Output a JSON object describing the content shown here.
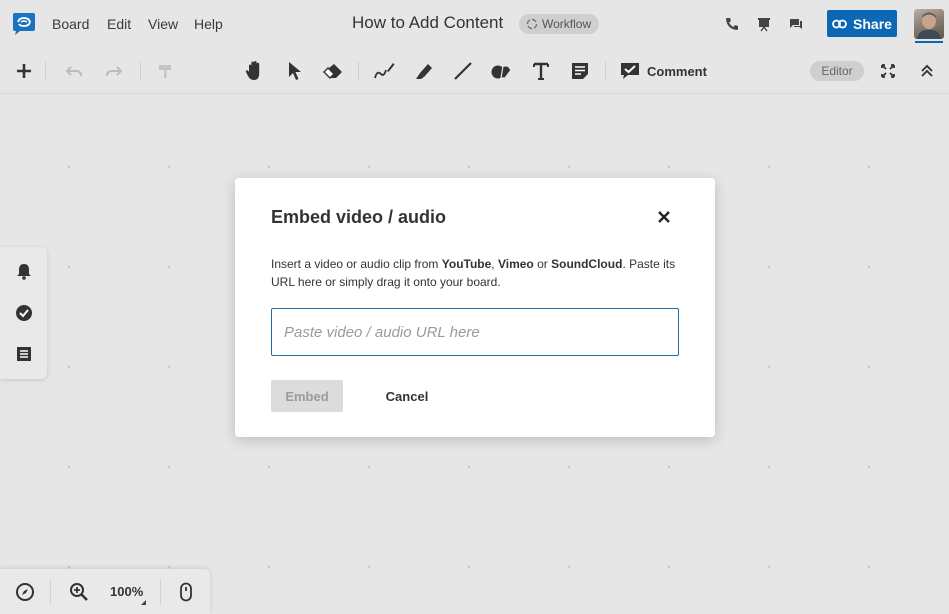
{
  "app": {
    "menu": [
      "Board",
      "Edit",
      "View",
      "Help"
    ],
    "board_title": "How to Add Content",
    "workflow_badge": "Workflow",
    "share_label": "Share",
    "brand_color": "#0d67b5"
  },
  "toolbar": {
    "comment_label": "Comment",
    "editor_badge": "Editor",
    "tools": [
      "add-icon",
      "undo-icon",
      "redo-icon",
      "format-painter-icon",
      "hand-icon",
      "pointer-icon",
      "eraser-icon",
      "pen-icon",
      "highlighter-icon",
      "line-icon",
      "shapes-icon",
      "text-icon",
      "sticky-note-icon",
      "comment-icon",
      "fullscreen-icon",
      "collapse-icon"
    ]
  },
  "left_panel": {
    "icons": [
      "bell-icon",
      "check-circle-icon",
      "list-icon"
    ]
  },
  "bottom_bar": {
    "zoom_level": "100%"
  },
  "modal": {
    "title": "Embed video / audio",
    "desc_pre": "Insert a video or audio clip from ",
    "source_1": "YouTube",
    "sep_1": ", ",
    "source_2": "Vimeo",
    "sep_2": " or ",
    "source_3": "SoundCloud",
    "desc_post": ". Paste its URL here or simply drag it onto your board.",
    "input_value": "",
    "input_placeholder": "Paste video / audio URL here",
    "embed_label": "Embed",
    "cancel_label": "Cancel"
  }
}
